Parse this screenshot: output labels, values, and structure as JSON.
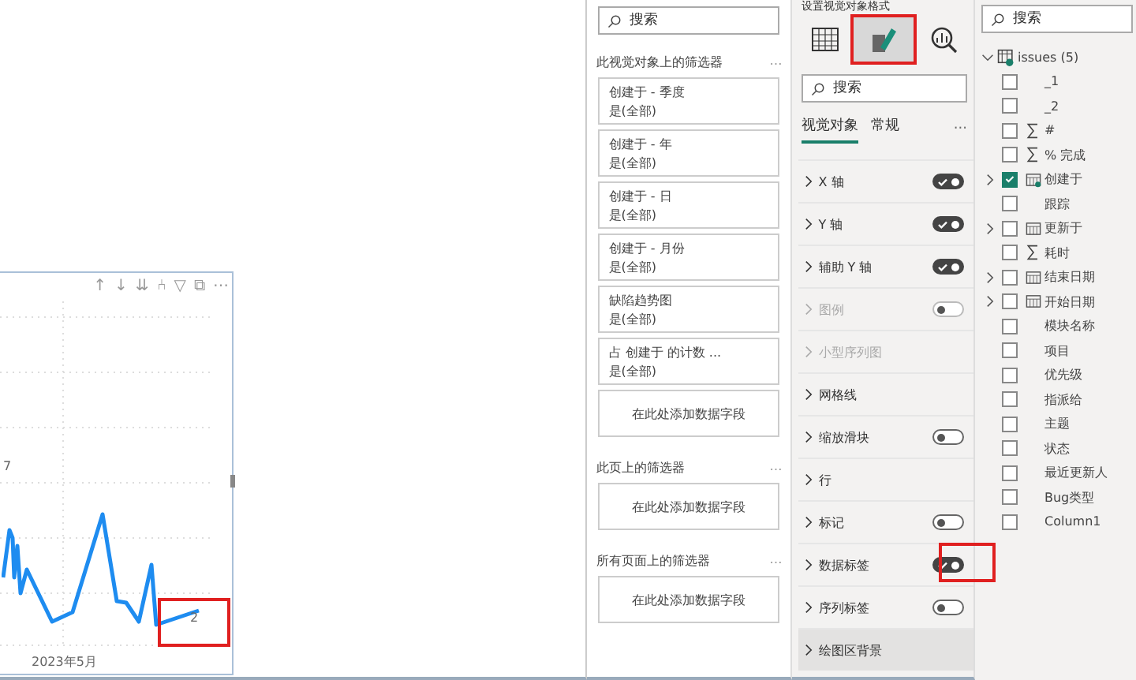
{
  "chart": {
    "toolbar": [
      "↑",
      "↓",
      "⇊",
      "⑃",
      "▽",
      "⧉",
      "⋯"
    ],
    "data_labels": [
      {
        "text": "7",
        "highlighted": false
      },
      {
        "text": "2",
        "highlighted": true
      }
    ],
    "x_label": "2023年5月"
  },
  "filters_pane": {
    "search": {
      "placeholder": "搜索"
    },
    "sections": [
      {
        "title": "此视觉对象上的筛选器",
        "more": "…",
        "cards": [
          {
            "name": "创建于 - 季度",
            "value": "是(全部)"
          },
          {
            "name": "创建于 - 年",
            "value": "是(全部)"
          },
          {
            "name": "创建于 - 日",
            "value": "是(全部)"
          },
          {
            "name": "创建于 - 月份",
            "value": "是(全部)"
          },
          {
            "name": "缺陷趋势图",
            "value": "是(全部)"
          },
          {
            "name": "占 创建于 的计数 ...",
            "value": "是(全部)"
          }
        ],
        "drop": "在此处添加数据字段"
      },
      {
        "title": "此页上的筛选器",
        "more": "…",
        "drop": "在此处添加数据字段"
      },
      {
        "title": "所有页面上的筛选器",
        "more": "…",
        "drop": "在此处添加数据字段"
      }
    ]
  },
  "format_pane": {
    "title": "设置视觉对象格式",
    "mode_icons": [
      {
        "kind": "build",
        "selected": false,
        "highlighted": false
      },
      {
        "kind": "format",
        "selected": true,
        "highlighted": true
      },
      {
        "kind": "analytics",
        "selected": false,
        "highlighted": false
      }
    ],
    "search": {
      "placeholder": "搜索"
    },
    "tabs": [
      {
        "label": "视觉对象",
        "selected": true
      },
      {
        "label": "常规",
        "selected": false
      }
    ],
    "more": "···",
    "sections": [
      {
        "label": "X 轴",
        "disabled": false,
        "selected": false,
        "toggle": {
          "on": true,
          "highlighted": false
        }
      },
      {
        "label": "Y 轴",
        "disabled": false,
        "selected": false,
        "toggle": {
          "on": true,
          "highlighted": false
        }
      },
      {
        "label": "辅助 Y 轴",
        "disabled": false,
        "selected": false,
        "toggle": {
          "on": true,
          "highlighted": false
        }
      },
      {
        "label": "图例",
        "disabled": true,
        "selected": false,
        "toggle": {
          "on": false,
          "highlighted": false
        }
      },
      {
        "label": "小型序列图",
        "disabled": true,
        "selected": false
      },
      {
        "label": "网格线",
        "disabled": false,
        "selected": false
      },
      {
        "label": "缩放滑块",
        "disabled": false,
        "selected": false,
        "toggle": {
          "on": false,
          "highlighted": false
        }
      },
      {
        "label": "行",
        "disabled": false,
        "selected": false
      },
      {
        "label": "标记",
        "disabled": false,
        "selected": false,
        "toggle": {
          "on": false,
          "highlighted": false
        }
      },
      {
        "label": "数据标签",
        "disabled": false,
        "selected": false,
        "toggle": {
          "on": true,
          "highlighted": true
        }
      },
      {
        "label": "序列标签",
        "disabled": false,
        "selected": false,
        "toggle": {
          "on": false,
          "highlighted": false
        }
      },
      {
        "label": "绘图区背景",
        "disabled": false,
        "selected": true
      }
    ]
  },
  "fields_pane": {
    "search": {
      "placeholder": "搜索"
    },
    "table": {
      "name": "issues (5)",
      "expanded": true,
      "fields": [
        {
          "name": "_1",
          "kind": "text",
          "checked": false,
          "expandable": false
        },
        {
          "name": "_2",
          "kind": "text",
          "checked": false,
          "expandable": false
        },
        {
          "name": "#",
          "kind": "sum",
          "checked": false,
          "expandable": false
        },
        {
          "name": "% 完成",
          "kind": "sum",
          "checked": false,
          "expandable": false
        },
        {
          "name": "创建于",
          "kind": "date",
          "checked": true,
          "expandable": true
        },
        {
          "name": "跟踪",
          "kind": "text",
          "checked": false,
          "expandable": false
        },
        {
          "name": "更新于",
          "kind": "date",
          "checked": false,
          "expandable": true
        },
        {
          "name": "耗时",
          "kind": "sum",
          "checked": false,
          "expandable": false
        },
        {
          "name": "结束日期",
          "kind": "date",
          "checked": false,
          "expandable": true
        },
        {
          "name": "开始日期",
          "kind": "date",
          "checked": false,
          "expandable": true
        },
        {
          "name": "模块名称",
          "kind": "text",
          "checked": false,
          "expandable": false
        },
        {
          "name": "项目",
          "kind": "text",
          "checked": false,
          "expandable": false
        },
        {
          "name": "优先级",
          "kind": "text",
          "checked": false,
          "expandable": false
        },
        {
          "name": "指派给",
          "kind": "text",
          "checked": false,
          "expandable": false
        },
        {
          "name": "主题",
          "kind": "text",
          "checked": false,
          "expandable": false
        },
        {
          "name": "状态",
          "kind": "text",
          "checked": false,
          "expandable": false
        },
        {
          "name": "最近更新人",
          "kind": "text",
          "checked": false,
          "expandable": false
        },
        {
          "name": "Bug类型",
          "kind": "text",
          "checked": false,
          "expandable": false
        },
        {
          "name": "Column1",
          "kind": "text",
          "checked": false,
          "expandable": false
        }
      ]
    }
  }
}
